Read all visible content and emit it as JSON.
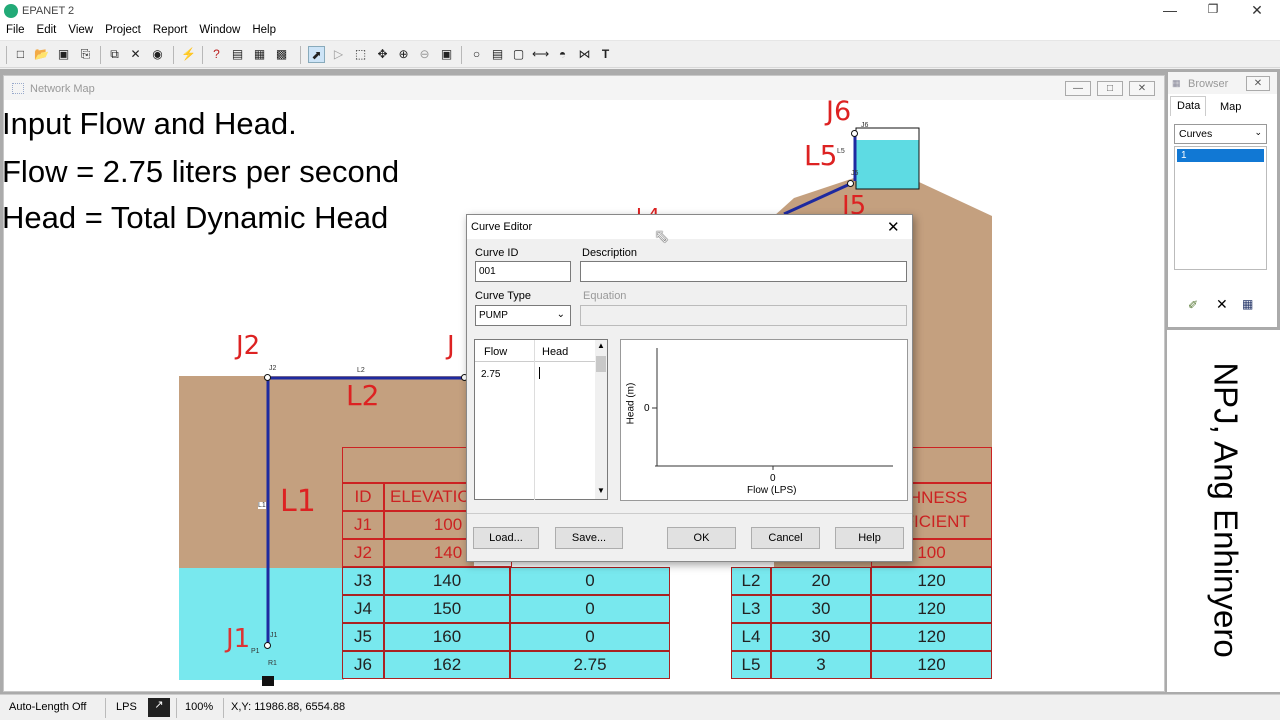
{
  "app": {
    "title": "EPANET 2"
  },
  "window_controls": {
    "minimize": "—",
    "restore": "❐",
    "close": "✕"
  },
  "menu": [
    "File",
    "Edit",
    "View",
    "Project",
    "Report",
    "Window",
    "Help"
  ],
  "toolbar_icons": [
    "new-icon",
    "open-icon",
    "save-icon",
    "print-icon",
    "copy-icon",
    "delete-icon",
    "find-icon",
    "run-icon",
    "query-icon",
    "graph-icon",
    "table-icon",
    "options-icon",
    "select-icon",
    "vertex-icon",
    "select-region-icon",
    "pan-icon",
    "zoom-in-icon",
    "zoom-out-icon",
    "full-extent-icon",
    "junction-icon",
    "reservoir-icon",
    "tank-icon",
    "pipe-icon",
    "pump-icon",
    "valve-icon",
    "label-icon"
  ],
  "network_map": {
    "title": "Network Map",
    "overlay_lines": [
      "Input Flow and Head.",
      "Flow = 2.75 liters per second",
      "Head = Total Dynamic Head"
    ],
    "labels": {
      "j2": "J2",
      "l2": "L2",
      "l1": "L1",
      "j1": "J1",
      "j6": "J6",
      "l5": "L5",
      "j5_partial": "J5",
      "l4_partial": "L4",
      "j3_partial": "J"
    },
    "node_tags": {
      "j2": "J2",
      "l2": "L2",
      "l1": "L1",
      "j1": "J1",
      "p1": "P1",
      "r1": "R1",
      "j6": "J6",
      "l5": "L5",
      "j5": "J5"
    },
    "junction_table": {
      "headers": [
        "ID",
        "ELEVATION"
      ],
      "rows": [
        [
          "J1",
          "100",
          ""
        ],
        [
          "J2",
          "140",
          ""
        ],
        [
          "J3",
          "140",
          "0"
        ],
        [
          "J4",
          "150",
          "0"
        ],
        [
          "J5",
          "160",
          "0"
        ],
        [
          "J6",
          "162",
          "2.75"
        ]
      ]
    },
    "pipe_table": {
      "headers": [
        "ROUGHNESS",
        "COEFFICIENT"
      ],
      "header_visible": [
        "GHNESS",
        "FFICIENT"
      ],
      "rows": [
        [
          "",
          "",
          "100"
        ],
        [
          "L2",
          "20",
          "120"
        ],
        [
          "L3",
          "30",
          "120"
        ],
        [
          "L4",
          "30",
          "120"
        ],
        [
          "L5",
          "3",
          "120"
        ]
      ]
    }
  },
  "browser": {
    "title": "Browser",
    "tabs": [
      "Data",
      "Map"
    ],
    "category": "Curves",
    "items": [
      "1"
    ],
    "actions": [
      "add-icon",
      "delete-icon",
      "edit-icon"
    ]
  },
  "watermark": "NPJ, Ang Enhinyero",
  "curve_editor": {
    "title": "Curve Editor",
    "curve_id_label": "Curve ID",
    "curve_id_value": "001",
    "description_label": "Description",
    "description_value": "",
    "curve_type_label": "Curve Type",
    "curve_type_value": "PUMP",
    "equation_label": "Equation",
    "grid_headers": [
      "Flow",
      "Head"
    ],
    "grid_rows": [
      [
        "2.75",
        ""
      ]
    ],
    "plot": {
      "xlabel": "Flow (LPS)",
      "ylabel": "Head (m)",
      "x_tick": "0",
      "y_tick": "0"
    },
    "buttons": {
      "load": "Load...",
      "save": "Save...",
      "ok": "OK",
      "cancel": "Cancel",
      "help": "Help"
    }
  },
  "status_bar": {
    "auto_length": "Auto-Length Off",
    "units": "LPS",
    "zoom": "100%",
    "coords": "X,Y: 11986.88, 6554.88"
  }
}
